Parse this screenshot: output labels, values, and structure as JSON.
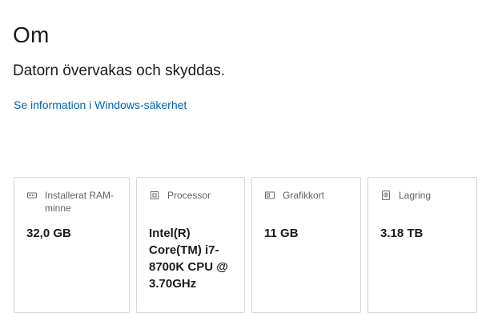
{
  "page": {
    "title": "Om",
    "status": "Datorn övervakas och skyddas.",
    "security_link": "Se information i Windows-säkerhet"
  },
  "specs": [
    {
      "icon": "memory-icon",
      "label": "Installerat RAM-minne",
      "value": "32,0 GB"
    },
    {
      "icon": "processor-icon",
      "label": "Processor",
      "value": "Intel(R) Core(TM) i7-8700K CPU @ 3.70GHz"
    },
    {
      "icon": "graphics-card-icon",
      "label": "Grafikkort",
      "value": "11 GB"
    },
    {
      "icon": "storage-icon",
      "label": "Lagring",
      "value": "3.18 TB"
    }
  ],
  "colors": {
    "link": "#0063b1",
    "card_border": "#d6d6d6",
    "label_text": "#616161"
  }
}
